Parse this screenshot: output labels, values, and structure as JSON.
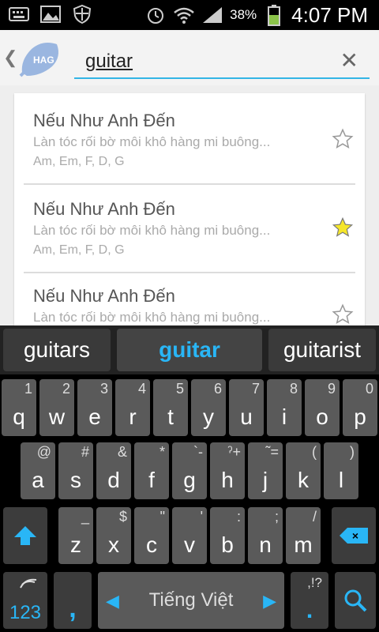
{
  "status_bar": {
    "battery_percent": "38%",
    "time": "4:07 PM",
    "icons": [
      "keyboard-icon",
      "image-icon",
      "shield-icon",
      "alarm-icon",
      "wifi-icon",
      "signal-icon",
      "battery-icon"
    ]
  },
  "search": {
    "query": "guitar",
    "logo": "app-logo"
  },
  "results": [
    {
      "title": "Nếu Như Anh Đến",
      "lyric": "Làn tóc rối bờ môi khô hàng mi buông...",
      "chords": "Am, Em, F, D, G",
      "starred": false
    },
    {
      "title": "Nếu Như Anh Đến",
      "lyric": "Làn tóc rối bờ môi khô hàng mi buông...",
      "chords": "Am, Em, F, D, G",
      "starred": true
    },
    {
      "title": "Nếu Như Anh Đến",
      "lyric": "Làn tóc rối bờ môi khô hàng mi buông...",
      "chords": "",
      "starred": false
    }
  ],
  "keyboard": {
    "suggestions": [
      "guitars",
      "guitar",
      "guitarist"
    ],
    "row1": [
      [
        "q",
        "1"
      ],
      [
        "w",
        "2"
      ],
      [
        "e",
        "3"
      ],
      [
        "r",
        "4"
      ],
      [
        "t",
        "5"
      ],
      [
        "y",
        "6"
      ],
      [
        "u",
        "7"
      ],
      [
        "i",
        "8"
      ],
      [
        "o",
        "9"
      ],
      [
        "p",
        "0"
      ]
    ],
    "row2": [
      [
        "a",
        "@"
      ],
      [
        "s",
        "#"
      ],
      [
        "d",
        "&"
      ],
      [
        "f",
        "*"
      ],
      [
        "g",
        "`-"
      ],
      [
        "h",
        "ˀ+"
      ],
      [
        "j",
        "˜="
      ],
      [
        "k",
        "("
      ],
      [
        "l",
        ")"
      ]
    ],
    "row3": [
      [
        "z",
        "_"
      ],
      [
        "x",
        "$"
      ],
      [
        "c",
        "\""
      ],
      [
        "v",
        "'"
      ],
      [
        "b",
        ":"
      ],
      [
        "n",
        ";"
      ],
      [
        "m",
        "/"
      ]
    ],
    "symbols_label": "123",
    "comma": ",",
    "space_label": "Tiếng Việt",
    "period": ".",
    "period_sub": ",!?",
    "colors": {
      "accent": "#29b6f6",
      "key": "#5a5a5a"
    }
  }
}
